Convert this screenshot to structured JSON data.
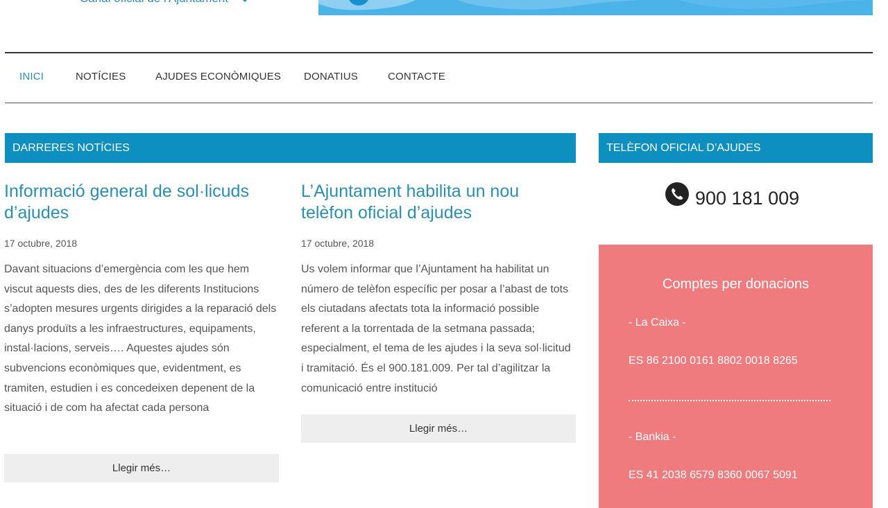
{
  "header": {
    "tagline": "Canal oficial de l'Ajuntament",
    "tagline_icon": "heart-icon",
    "banner_color": "#4bb3e8"
  },
  "nav": {
    "items": [
      {
        "label": "INICI",
        "active": true
      },
      {
        "label": "NOTÍCIES"
      },
      {
        "label": "AJUDES ECONÒMIQUES"
      },
      {
        "label": "DONATIUS"
      },
      {
        "label": "CONTACTE"
      }
    ]
  },
  "news": {
    "heading": "DARRERES NOTÍCIES",
    "posts": [
      {
        "title": "Informació general de sol·licuds d’ajudes",
        "date": "17 octubre, 2018",
        "excerpt": "Davant situacions d’emergència com les que hem viscut aquests dies, des de les diferents Institucions s’adopten mesures urgents dirigides a la reparació dels danys produïts a les infraestructures, equipaments, instal·lacions, serveis…. Aquestes ajudes són subvencions econòmiques que, evidentment, es tramiten, estudien i es concedeixen depenent de la situació i de com ha afectat cada persona",
        "read_more": "Llegir més…"
      },
      {
        "title": "L’Ajuntament habilita un nou telèfon oficial d’ajudes",
        "date": "17 octubre, 2018",
        "excerpt": "Us volem informar que l’Ajuntament ha habilitat un número de telèfon específic per posar a l’abast de tots els ciutadans afectats tota la informació possible referent a la torrentada de la setmana passada; especialment, el tema de les ajudes i la seva sol·licitud i tramitació. És el 900.181.009. Per tal d’agilitzar la comunicació entre institució",
        "read_more": "Llegir més…"
      }
    ]
  },
  "sidebar": {
    "phone_heading": "TELÈFON OFICIAL D’AJUDES",
    "phone_icon": "phone-icon",
    "phone_number": "900 181 009",
    "donations": {
      "title": "Comptes per donacions",
      "bank1_name": "- La Caixa -",
      "bank1_iban": "ES 86 2100 0161 8802 0018 8265",
      "bank2_name": "- Bankia -",
      "bank2_iban": "ES 41 2038 6579 8360 0067 5091",
      "background_color": "#ef7b7e"
    }
  },
  "colors": {
    "accent": "#0d8fbf",
    "link": "#2a8fb0",
    "button_bg": "#efeeee"
  }
}
